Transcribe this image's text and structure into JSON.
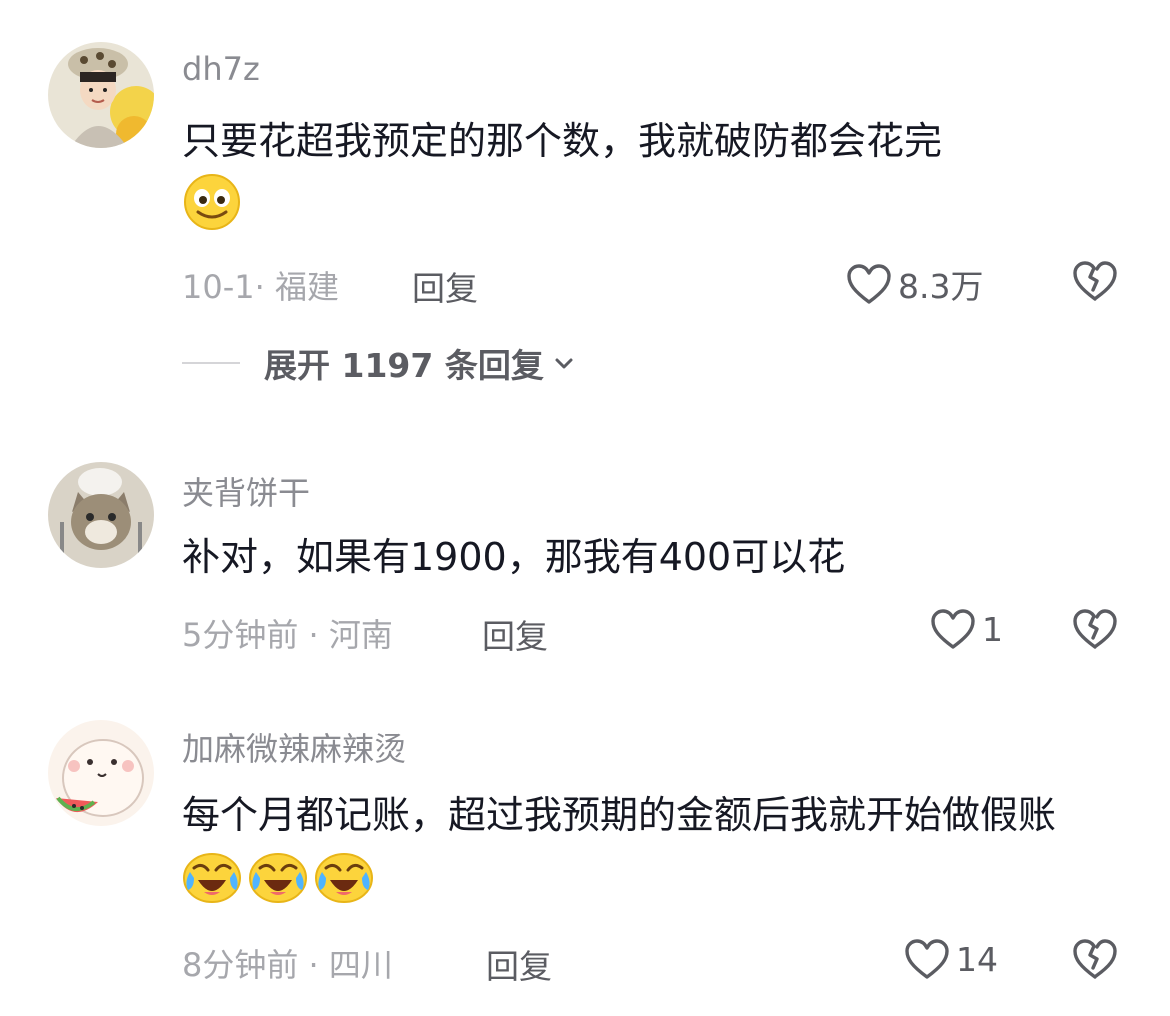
{
  "comments": [
    {
      "username": "dh7z",
      "text": "只要花超我预定的那个数，我就破防都会花完",
      "emojis": [
        "smile-emoji"
      ],
      "meta": "10-1· 福建",
      "reply_label": "回复",
      "likes": "8.3万"
    },
    {
      "username": "夹背饼干",
      "text": "补对，如果有1900，那我有400可以花",
      "emojis": [],
      "meta": "5分钟前 · 河南",
      "reply_label": "回复",
      "likes": "1"
    },
    {
      "username": "加麻微辣麻辣烫",
      "text": "每个月都记账，超过我预期的金额后我就开始做假账",
      "emojis": [
        "crying-laughing-emoji",
        "crying-laughing-emoji",
        "crying-laughing-emoji"
      ],
      "meta": "8分钟前 · 四川",
      "reply_label": "回复",
      "likes": "14"
    }
  ],
  "expand_replies": "展开 1197 条回复",
  "colors": {
    "text": "#161823",
    "username": "#8a8b91",
    "meta": "#a6a7ac",
    "action": "#5b5c62"
  }
}
